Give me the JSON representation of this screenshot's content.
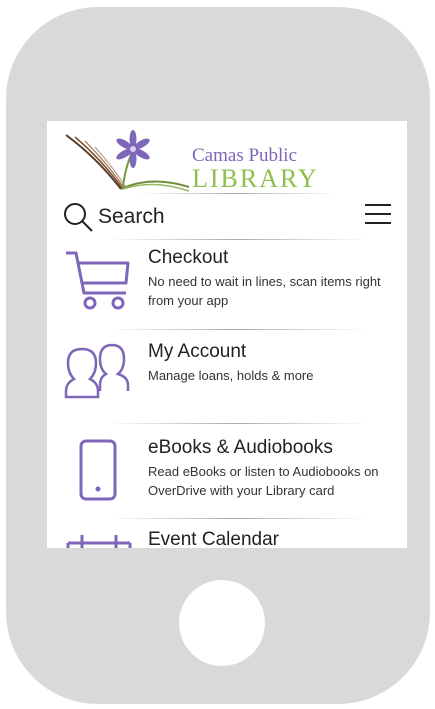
{
  "logo": {
    "line1": "Camas Public",
    "line2": "LIBRARY"
  },
  "search": {
    "label": "Search"
  },
  "menu_items": [
    {
      "title": "Checkout",
      "description": "No need to wait in lines, scan items right from your app",
      "icon": "shopping-cart-icon"
    },
    {
      "title": "My Account",
      "description": "Manage loans, holds & more",
      "icon": "users-icon"
    },
    {
      "title": "eBooks & Audiobooks",
      "description": "Read eBooks or listen to Audiobooks on OverDrive with your Library card",
      "icon": "phone-icon"
    },
    {
      "title": "Event Calendar",
      "description": "",
      "icon": "calendar-icon"
    }
  ],
  "colors": {
    "accent_purple": "#7e66b8",
    "accent_green": "#8cc04b",
    "device_gray": "#d9d9d9"
  }
}
